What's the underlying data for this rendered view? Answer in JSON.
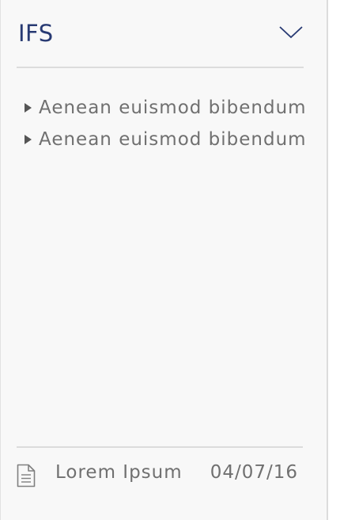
{
  "header": {
    "title": "IFS",
    "toggle_icon": "chevron-down-icon",
    "title_color": "#283a73"
  },
  "items": [
    {
      "label": "Aenean euismod bibendum",
      "icon": "caret-right-icon"
    },
    {
      "label": "Aenean euismod bibendum",
      "icon": "caret-right-icon"
    }
  ],
  "footer": {
    "icon": "document-icon",
    "name": "Lorem Ipsum",
    "date": "04/07/16"
  },
  "colors": {
    "text": "#707070",
    "divider": "#dcdcdc",
    "background": "#f8f8f8"
  }
}
